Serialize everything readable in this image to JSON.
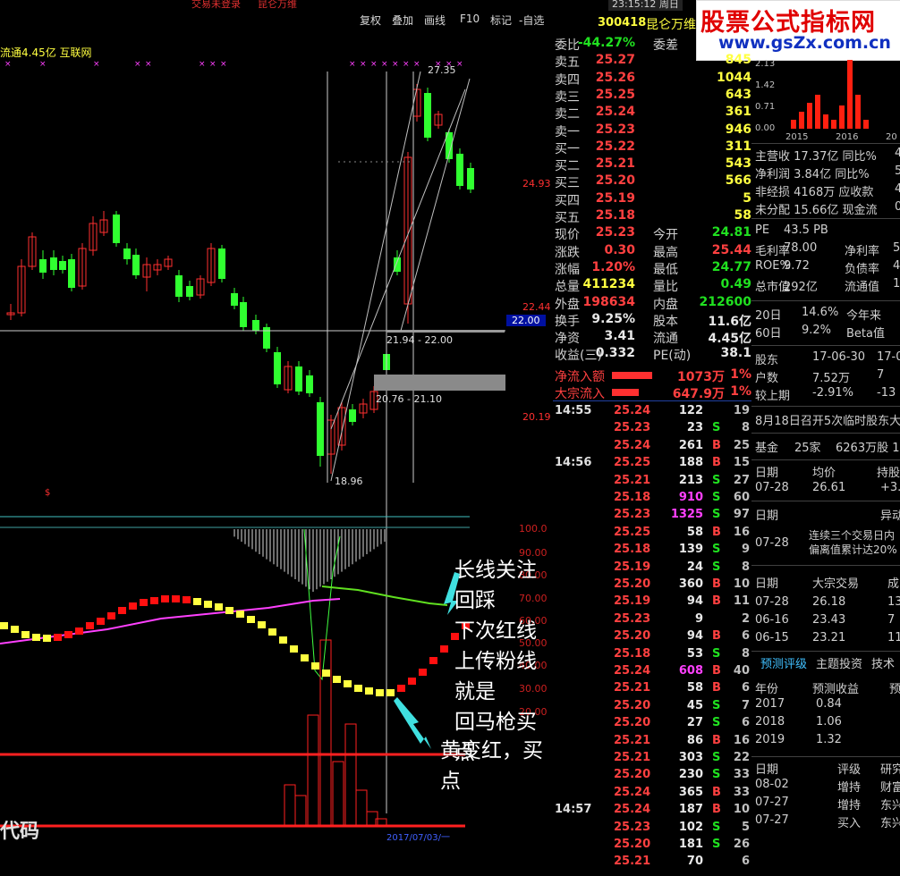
{
  "topbar": {
    "status_left": "交易未登录",
    "status_right": "昆仑万维",
    "time": "23:15:12 周日",
    "buttons": [
      "复权",
      "叠加",
      "画线",
      "F10",
      "标记",
      "-自选"
    ]
  },
  "stock": {
    "code": "300418",
    "name": "昆仑万维"
  },
  "logo": {
    "title": "股票公式指标网",
    "url": "www.gsZx.com.cn"
  },
  "chart": {
    "header": "流通4.45亿 互联网",
    "price_labels": [
      "27.35",
      "24.93",
      "22.44",
      "22.00",
      "21.94 - 22.00",
      "20.76 - 21.10",
      "20.19",
      "18.96"
    ],
    "scale_values": [
      "100.0",
      "90.00",
      "80.00",
      "70.00",
      "60.00",
      "50.00",
      "40.00",
      "30.00",
      "20.00"
    ],
    "bottom_text": "代码",
    "bottom_date": "2017/07/03/一",
    "annotation_1": [
      "长线关注回踩",
      "下次红线上传粉线就是",
      "回马枪买点"
    ],
    "annotation_2": "黄变红，买点",
    "colors": {
      "up": "#ff3030",
      "down": "#30ff30",
      "yellow": "#ffff40",
      "magenta": "#ff40ff",
      "accent": "#2040a0"
    }
  },
  "quote": {
    "rows": [
      {
        "lbl": "委比",
        "val": "-44.27%",
        "lbl2": "委差",
        "val2": "",
        "c": "green",
        "c2": "white"
      },
      {
        "lbl": "卖五",
        "val": "25.27",
        "lbl2": "",
        "val2": "845",
        "c": "red",
        "c2": "yellow"
      },
      {
        "lbl": "卖四",
        "val": "25.26",
        "lbl2": "",
        "val2": "1044",
        "c": "red",
        "c2": "yellow"
      },
      {
        "lbl": "卖三",
        "val": "25.25",
        "lbl2": "",
        "val2": "643",
        "c": "red",
        "c2": "yellow"
      },
      {
        "lbl": "卖二",
        "val": "25.24",
        "lbl2": "",
        "val2": "361",
        "c": "red",
        "c2": "yellow"
      },
      {
        "lbl": "卖一",
        "val": "25.23",
        "lbl2": "",
        "val2": "946",
        "c": "red",
        "c2": "yellow"
      },
      {
        "lbl": "买一",
        "val": "25.22",
        "lbl2": "",
        "val2": "311",
        "c": "red",
        "c2": "yellow"
      },
      {
        "lbl": "买二",
        "val": "25.21",
        "lbl2": "",
        "val2": "543",
        "c": "red",
        "c2": "yellow"
      },
      {
        "lbl": "买三",
        "val": "25.20",
        "lbl2": "",
        "val2": "566",
        "c": "red",
        "c2": "yellow"
      },
      {
        "lbl": "买四",
        "val": "25.19",
        "lbl2": "",
        "val2": "5",
        "c": "red",
        "c2": "yellow"
      },
      {
        "lbl": "买五",
        "val": "25.18",
        "lbl2": "",
        "val2": "58",
        "c": "red",
        "c2": "yellow"
      },
      {
        "lbl": "现价",
        "val": "25.23",
        "lbl2": "今开",
        "val2": "24.81",
        "c": "red",
        "c2": "green"
      },
      {
        "lbl": "涨跌",
        "val": "0.30",
        "lbl2": "最高",
        "val2": "25.44",
        "c": "red",
        "c2": "red"
      },
      {
        "lbl": "涨幅",
        "val": "1.20%",
        "lbl2": "最低",
        "val2": "24.77",
        "c": "red",
        "c2": "green"
      },
      {
        "lbl": "总量",
        "val": "411234",
        "lbl2": "量比",
        "val2": "0.49",
        "c": "yellow",
        "c2": "green"
      },
      {
        "lbl": "外盘",
        "val": "198634",
        "lbl2": "内盘",
        "val2": "212600",
        "c": "red",
        "c2": "green"
      },
      {
        "lbl": "换手",
        "val": "9.25%",
        "lbl2": "股本",
        "val2": "11.6亿",
        "c": "white",
        "c2": "white"
      },
      {
        "lbl": "净资",
        "val": "3.41",
        "lbl2": "流通",
        "val2": "4.45亿",
        "c": "white",
        "c2": "white"
      },
      {
        "lbl": "收益(三)",
        "val": "0.332",
        "lbl2": "PE(动)",
        "val2": "38.1",
        "c": "white",
        "c2": "white"
      }
    ],
    "flow": [
      {
        "lbl": "净流入额",
        "val": "1073万",
        "pct": "1%",
        "frac": 0.75
      },
      {
        "lbl": "大宗流入",
        "val": "647.9万",
        "pct": "1%",
        "frac": 0.5
      }
    ],
    "ticks": [
      {
        "t": "14:55",
        "p": "25.24",
        "v": "122",
        "d": "",
        "n": "19",
        "pc": "red",
        "vc": "white",
        "dc": "white"
      },
      {
        "t": "",
        "p": "25.23",
        "v": "23",
        "d": "S",
        "n": "8",
        "pc": "red",
        "vc": "white",
        "dc": "green"
      },
      {
        "t": "",
        "p": "25.24",
        "v": "261",
        "d": "B",
        "n": "25",
        "pc": "red",
        "vc": "white",
        "dc": "red"
      },
      {
        "t": "14:56",
        "p": "25.25",
        "v": "188",
        "d": "B",
        "n": "15",
        "pc": "red",
        "vc": "white",
        "dc": "red"
      },
      {
        "t": "",
        "p": "25.21",
        "v": "213",
        "d": "S",
        "n": "27",
        "pc": "red",
        "vc": "white",
        "dc": "green"
      },
      {
        "t": "",
        "p": "25.18",
        "v": "910",
        "d": "S",
        "n": "60",
        "pc": "red",
        "vc": "magenta",
        "dc": "green"
      },
      {
        "t": "",
        "p": "25.23",
        "v": "1325",
        "d": "S",
        "n": "97",
        "pc": "red",
        "vc": "magenta",
        "dc": "green"
      },
      {
        "t": "",
        "p": "25.25",
        "v": "58",
        "d": "B",
        "n": "16",
        "pc": "red",
        "vc": "white",
        "dc": "red"
      },
      {
        "t": "",
        "p": "25.18",
        "v": "139",
        "d": "S",
        "n": "9",
        "pc": "red",
        "vc": "white",
        "dc": "green"
      },
      {
        "t": "",
        "p": "25.19",
        "v": "24",
        "d": "S",
        "n": "8",
        "pc": "red",
        "vc": "white",
        "dc": "green"
      },
      {
        "t": "",
        "p": "25.20",
        "v": "360",
        "d": "B",
        "n": "10",
        "pc": "red",
        "vc": "white",
        "dc": "red"
      },
      {
        "t": "",
        "p": "25.19",
        "v": "94",
        "d": "B",
        "n": "11",
        "pc": "red",
        "vc": "white",
        "dc": "red"
      },
      {
        "t": "",
        "p": "25.23",
        "v": "9",
        "d": "",
        "n": "2",
        "pc": "red",
        "vc": "white",
        "dc": "white"
      },
      {
        "t": "",
        "p": "25.20",
        "v": "94",
        "d": "B",
        "n": "6",
        "pc": "red",
        "vc": "white",
        "dc": "red"
      },
      {
        "t": "",
        "p": "25.18",
        "v": "53",
        "d": "S",
        "n": "8",
        "pc": "red",
        "vc": "white",
        "dc": "green"
      },
      {
        "t": "",
        "p": "25.24",
        "v": "608",
        "d": "B",
        "n": "40",
        "pc": "red",
        "vc": "magenta",
        "dc": "red"
      },
      {
        "t": "",
        "p": "25.21",
        "v": "58",
        "d": "B",
        "n": "6",
        "pc": "red",
        "vc": "white",
        "dc": "red"
      },
      {
        "t": "",
        "p": "25.20",
        "v": "45",
        "d": "S",
        "n": "7",
        "pc": "red",
        "vc": "white",
        "dc": "green"
      },
      {
        "t": "",
        "p": "25.20",
        "v": "27",
        "d": "S",
        "n": "6",
        "pc": "red",
        "vc": "white",
        "dc": "green"
      },
      {
        "t": "",
        "p": "25.21",
        "v": "86",
        "d": "B",
        "n": "16",
        "pc": "red",
        "vc": "white",
        "dc": "red"
      },
      {
        "t": "",
        "p": "25.21",
        "v": "303",
        "d": "S",
        "n": "22",
        "pc": "red",
        "vc": "white",
        "dc": "green"
      },
      {
        "t": "",
        "p": "25.20",
        "v": "230",
        "d": "S",
        "n": "33",
        "pc": "red",
        "vc": "white",
        "dc": "green"
      },
      {
        "t": "",
        "p": "25.24",
        "v": "365",
        "d": "B",
        "n": "33",
        "pc": "red",
        "vc": "white",
        "dc": "red"
      },
      {
        "t": "14:57",
        "p": "25.24",
        "v": "187",
        "d": "B",
        "n": "10",
        "pc": "red",
        "vc": "white",
        "dc": "red"
      },
      {
        "t": "",
        "p": "25.23",
        "v": "102",
        "d": "S",
        "n": "5",
        "pc": "red",
        "vc": "white",
        "dc": "green"
      },
      {
        "t": "",
        "p": "25.20",
        "v": "181",
        "d": "S",
        "n": "26",
        "pc": "red",
        "vc": "white",
        "dc": "green"
      },
      {
        "t": "",
        "p": "25.21",
        "v": "70",
        "d": "",
        "n": "6",
        "pc": "red",
        "vc": "white",
        "dc": "white"
      }
    ]
  },
  "finance": {
    "minichart": {
      "y_ticks": [
        "2.13",
        "1.42",
        "0.71",
        "0.00"
      ],
      "x_ticks": [
        "2015",
        "2016",
        "20"
      ],
      "values": [
        0.3,
        0.6,
        0.9,
        1.2,
        0.5,
        0.3,
        0.8,
        2.4,
        1.2,
        0.3
      ]
    },
    "rows": [
      "主营收 17.37亿 同比%",
      "净利润 3.84亿 同比%",
      "非经损 4168万 应收款",
      "未分配 15.66亿 现金流"
    ],
    "row_tails": [
      "4",
      "5",
      "4.",
      "0"
    ],
    "valuation": [
      [
        "PE",
        "43.5 PB",
        "",
        ""
      ],
      [
        "毛利率",
        "78.00",
        "净利率",
        "5"
      ],
      [
        "ROE%",
        "9.72",
        "负债率",
        "4"
      ],
      [
        "总市值",
        "292亿",
        "流通值",
        "1"
      ]
    ],
    "perf": [
      [
        "20日",
        "14.6%",
        "今年来",
        ""
      ],
      [
        "60日",
        "9.2%",
        "Beta值",
        ""
      ]
    ],
    "holders": [
      [
        "股东",
        "17-06-30",
        "17-0"
      ],
      [
        "户数",
        "7.52万",
        "7"
      ],
      [
        "较上期",
        "-2.91%",
        "-13"
      ]
    ],
    "notice": "8月18日召开5次临时股东大",
    "fund": [
      "基金",
      "25家",
      "6263万股 1"
    ],
    "rating_hdr": [
      "日期",
      "均价",
      "持股"
    ],
    "rating_row": [
      "07-28",
      "26.61",
      "+3."
    ],
    "abnormal_hdr": [
      "日期",
      "异动"
    ],
    "abnormal_text": [
      "连续三个交易日内",
      "偏离值累计达20%"
    ],
    "abnormal_date": "07-28",
    "block_hdr": [
      "日期",
      "大宗交易",
      "成"
    ],
    "blocks": [
      [
        "07-28",
        "26.18",
        "13"
      ],
      [
        "06-16",
        "23.43",
        "7"
      ],
      [
        "06-15",
        "23.21",
        "11"
      ]
    ],
    "tabs": [
      "预测评级",
      "主题投资",
      "技术"
    ],
    "forecast_hdr": [
      "年份",
      "预测收益",
      "预"
    ],
    "forecast": [
      [
        "2017",
        "0.84"
      ],
      [
        "2018",
        "1.06"
      ],
      [
        "2019",
        "1.32"
      ]
    ],
    "ratings_hdr": [
      "日期",
      "评级",
      "研究"
    ],
    "ratings": [
      [
        "08-02",
        "增持",
        "财富"
      ],
      [
        "07-27",
        "增持",
        "东兴"
      ],
      [
        "07-27",
        "买入",
        "东兴"
      ]
    ]
  }
}
